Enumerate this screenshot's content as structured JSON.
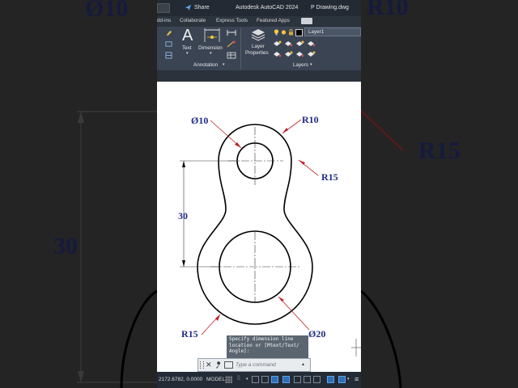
{
  "app": {
    "title": "Autodesk AutoCAD 2024",
    "file": "P Drawing.dwg",
    "share_label": "Share"
  },
  "tabs": [
    "dd-ins",
    "Collaborate",
    "Express Tools",
    "Featured Apps"
  ],
  "ribbon": {
    "text_label": "Text",
    "dimension_label": "Dimension",
    "layer_properties_label_1": "Layer",
    "layer_properties_label_2": "Properties",
    "annotation_panel": "Annotation",
    "layers_panel": "Layers",
    "current_layer": "Layer1"
  },
  "drawing": {
    "dia_small": "Ø10",
    "r_top": "R10",
    "r_waist": "R15",
    "dim_30": "30",
    "r_bottom": "R15",
    "dia_big": "Ø20"
  },
  "background_labels": {
    "dia_small": "Ø10",
    "r_top": "R10",
    "r_right": "R15",
    "dim_30": "30"
  },
  "command": {
    "prompt_line_1": "Specify dimension line",
    "prompt_line_2": "location or [Mtext/Text/",
    "prompt_line_3": "Angle]:",
    "placeholder": "Type a command"
  },
  "status": {
    "coordinates": "2172.6782, 0.0000",
    "space": "MODEL"
  },
  "colors": {
    "annotation": "#1f2a86",
    "leader": "#c0202a",
    "ribbon": "#3b4453"
  }
}
